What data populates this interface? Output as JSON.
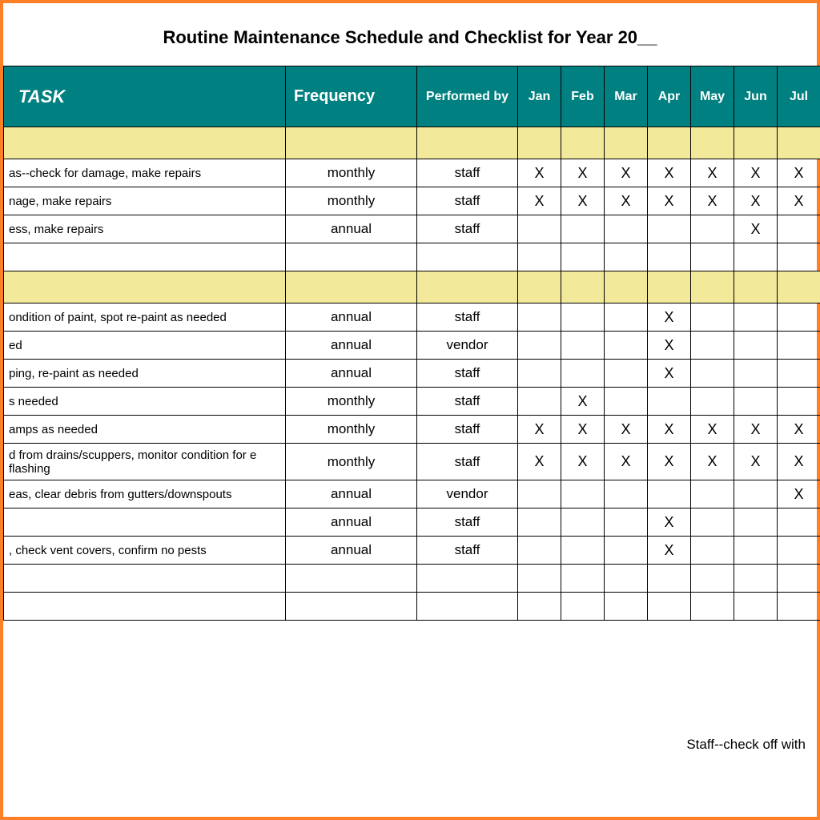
{
  "title": "Routine Maintenance Schedule and Checklist for Year 20__",
  "headers": {
    "task": "TASK",
    "frequency": "Frequency",
    "performed_by": "Performed by",
    "months": [
      "Jan",
      "Feb",
      "Mar",
      "Apr",
      "May",
      "Jun",
      "Jul"
    ]
  },
  "mark": "X",
  "sections": [
    {
      "rows": [
        {
          "task": "as--check for damage, make repairs",
          "freq": "monthly",
          "perf": "staff",
          "months": [
            true,
            true,
            true,
            true,
            true,
            true,
            true
          ]
        },
        {
          "task": "nage, make repairs",
          "freq": "monthly",
          "perf": "staff",
          "months": [
            true,
            true,
            true,
            true,
            true,
            true,
            true
          ]
        },
        {
          "task": "ess, make repairs",
          "freq": "annual",
          "perf": "staff",
          "months": [
            false,
            false,
            false,
            false,
            false,
            true,
            false
          ]
        },
        {
          "task": "",
          "freq": "",
          "perf": "",
          "months": [
            false,
            false,
            false,
            false,
            false,
            false,
            false
          ]
        }
      ]
    },
    {
      "rows": [
        {
          "task": "ondition of paint, spot re-paint as needed",
          "freq": "annual",
          "perf": "staff",
          "months": [
            false,
            false,
            false,
            true,
            false,
            false,
            false
          ]
        },
        {
          "task": "ed",
          "freq": "annual",
          "perf": "vendor",
          "months": [
            false,
            false,
            false,
            true,
            false,
            false,
            false
          ]
        },
        {
          "task": "ping, re-paint as needed",
          "freq": "annual",
          "perf": "staff",
          "months": [
            false,
            false,
            false,
            true,
            false,
            false,
            false
          ]
        },
        {
          "task": "s needed",
          "freq": "monthly",
          "perf": "staff",
          "months": [
            false,
            true,
            false,
            false,
            false,
            false,
            false
          ]
        },
        {
          "task": "amps as needed",
          "freq": "monthly",
          "perf": "staff",
          "months": [
            true,
            true,
            true,
            true,
            true,
            true,
            true
          ]
        },
        {
          "task": "d from drains/scuppers, monitor condition for e flashing",
          "tall": true,
          "freq": "monthly",
          "perf": "staff",
          "months": [
            true,
            true,
            true,
            true,
            true,
            true,
            true
          ]
        },
        {
          "task": "eas, clear debris from gutters/downspouts",
          "freq": "annual",
          "perf": "vendor",
          "months": [
            false,
            false,
            false,
            false,
            false,
            false,
            true
          ]
        },
        {
          "task": "",
          "freq": "annual",
          "perf": "staff",
          "months": [
            false,
            false,
            false,
            true,
            false,
            false,
            false
          ]
        },
        {
          "task": ", check vent covers, confirm no pests",
          "freq": "annual",
          "perf": "staff",
          "months": [
            false,
            false,
            false,
            true,
            false,
            false,
            false
          ]
        },
        {
          "task": "",
          "freq": "",
          "perf": "",
          "months": [
            false,
            false,
            false,
            false,
            false,
            false,
            false
          ]
        },
        {
          "task": "",
          "freq": "",
          "perf": "",
          "months": [
            false,
            false,
            false,
            false,
            false,
            false,
            false
          ]
        }
      ]
    }
  ],
  "footer": "Staff--check off with"
}
